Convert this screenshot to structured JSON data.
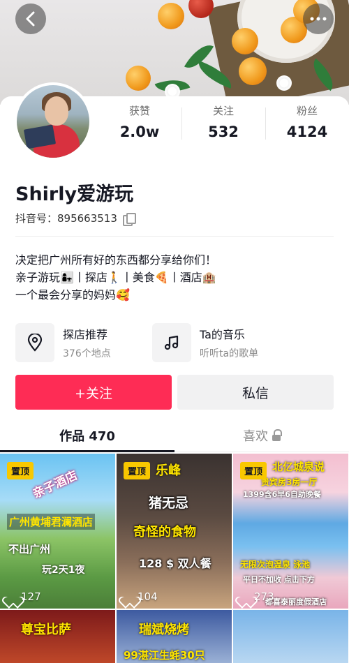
{
  "header": {
    "back_icon": "chevron-left-icon",
    "more_icon": "more-dots-icon"
  },
  "profile": {
    "name": "Shirly爱游玩",
    "douyin_id": "抖音号：895663513",
    "stats": [
      {
        "label": "获赞",
        "value": "2.0w"
      },
      {
        "label": "关注",
        "value": "532"
      },
      {
        "label": "粉丝",
        "value": "4124"
      }
    ],
    "bio": [
      "决定把广州所有好的东西都分享给你们！",
      "亲子游玩👩‍👧丨探店🚶丨美食🍕丨酒店🏨",
      "一个最会分享的妈妈🥰"
    ]
  },
  "features": [
    {
      "title": "探店推荐",
      "subtitle": "376个地点",
      "icon": "location-pin-icon"
    },
    {
      "title": "Ta的音乐",
      "subtitle": "听听ta的歌单",
      "icon": "music-note-icon"
    }
  ],
  "actions": {
    "follow_label": "+关注",
    "message_label": "私信"
  },
  "tabs": {
    "works_label": "作品 470",
    "likes_label": "喜欢"
  },
  "videos": [
    {
      "pinned": "置顶",
      "likes": "127",
      "captions": [
        "亲子酒店",
        "广州黄埔君澜酒店",
        "不出广州",
        "玩2天1夜"
      ]
    },
    {
      "pinned": "置顶",
      "likes": "104",
      "captions": [
        "乐峰",
        "猪无忌",
        "奇怪的食物",
        "128 $ 双人餐"
      ]
    },
    {
      "pinned": "置顶",
      "likes": "273",
      "captions": [
        "北亿城泉说",
        "贵宾房3房一厅",
        "1399含6早6自助晚餐",
        "无限次泡温泉 泳池",
        "平日不加收 点击下方",
        "都喜泰丽度假酒店"
      ]
    },
    {
      "captions": [
        "尊宝比萨"
      ]
    },
    {
      "captions": [
        "瑞斌烧烤",
        "99湛江生蚝30只"
      ]
    },
    {
      "captions": []
    }
  ],
  "colors": {
    "primary": "#fe2c55",
    "pin_badge": "#f8c800",
    "text_main": "#161823",
    "text_muted": "#8a8a8a"
  }
}
